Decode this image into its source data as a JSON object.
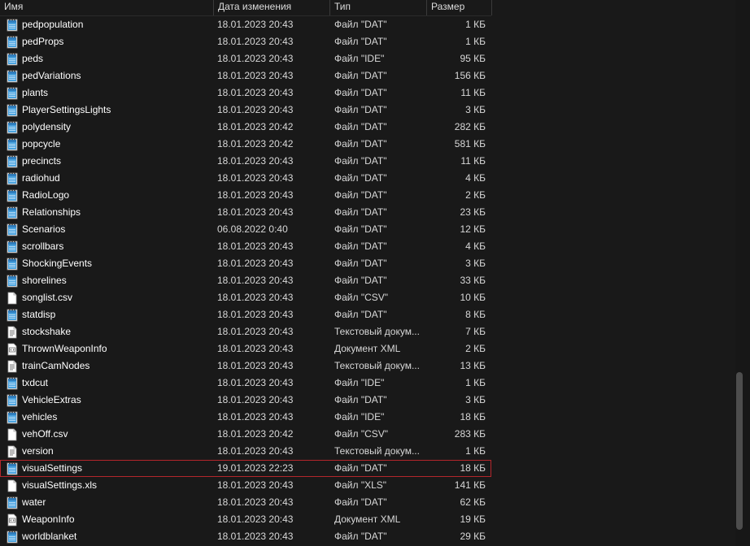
{
  "header": {
    "name": "Имя",
    "date": "Дата изменения",
    "type": "Тип",
    "size": "Размер"
  },
  "colors": {
    "background": "#191919",
    "selection_outline": "#b3262b",
    "notepad_icon": "#4aa3df"
  },
  "files": [
    {
      "name": "pedpopulation",
      "date": "18.01.2023 20:43",
      "type": "Файл \"DAT\"",
      "size": "1 КБ",
      "icon": "notepad-file-icon"
    },
    {
      "name": "pedProps",
      "date": "18.01.2023 20:43",
      "type": "Файл \"DAT\"",
      "size": "1 КБ",
      "icon": "notepad-file-icon"
    },
    {
      "name": "peds",
      "date": "18.01.2023 20:43",
      "type": "Файл \"IDE\"",
      "size": "95 КБ",
      "icon": "notepad-file-icon"
    },
    {
      "name": "pedVariations",
      "date": "18.01.2023 20:43",
      "type": "Файл \"DAT\"",
      "size": "156 КБ",
      "icon": "notepad-file-icon"
    },
    {
      "name": "plants",
      "date": "18.01.2023 20:43",
      "type": "Файл \"DAT\"",
      "size": "11 КБ",
      "icon": "notepad-file-icon"
    },
    {
      "name": "PlayerSettingsLights",
      "date": "18.01.2023 20:43",
      "type": "Файл \"DAT\"",
      "size": "3 КБ",
      "icon": "notepad-file-icon"
    },
    {
      "name": "polydensity",
      "date": "18.01.2023 20:42",
      "type": "Файл \"DAT\"",
      "size": "282 КБ",
      "icon": "notepad-file-icon"
    },
    {
      "name": "popcycle",
      "date": "18.01.2023 20:42",
      "type": "Файл \"DAT\"",
      "size": "581 КБ",
      "icon": "notepad-file-icon"
    },
    {
      "name": "precincts",
      "date": "18.01.2023 20:43",
      "type": "Файл \"DAT\"",
      "size": "11 КБ",
      "icon": "notepad-file-icon"
    },
    {
      "name": "radiohud",
      "date": "18.01.2023 20:43",
      "type": "Файл \"DAT\"",
      "size": "4 КБ",
      "icon": "notepad-file-icon"
    },
    {
      "name": "RadioLogo",
      "date": "18.01.2023 20:43",
      "type": "Файл \"DAT\"",
      "size": "2 КБ",
      "icon": "notepad-file-icon"
    },
    {
      "name": "Relationships",
      "date": "18.01.2023 20:43",
      "type": "Файл \"DAT\"",
      "size": "23 КБ",
      "icon": "notepad-file-icon"
    },
    {
      "name": "Scenarios",
      "date": "06.08.2022 0:40",
      "type": "Файл \"DAT\"",
      "size": "12 КБ",
      "icon": "notepad-file-icon"
    },
    {
      "name": "scrollbars",
      "date": "18.01.2023 20:43",
      "type": "Файл \"DAT\"",
      "size": "4 КБ",
      "icon": "notepad-file-icon"
    },
    {
      "name": "ShockingEvents",
      "date": "18.01.2023 20:43",
      "type": "Файл \"DAT\"",
      "size": "3 КБ",
      "icon": "notepad-file-icon"
    },
    {
      "name": "shorelines",
      "date": "18.01.2023 20:43",
      "type": "Файл \"DAT\"",
      "size": "33 КБ",
      "icon": "notepad-file-icon"
    },
    {
      "name": "songlist.csv",
      "date": "18.01.2023 20:43",
      "type": "Файл \"CSV\"",
      "size": "10 КБ",
      "icon": "blank-file-icon"
    },
    {
      "name": "statdisp",
      "date": "18.01.2023 20:43",
      "type": "Файл \"DAT\"",
      "size": "8 КБ",
      "icon": "notepad-file-icon"
    },
    {
      "name": "stockshake",
      "date": "18.01.2023 20:43",
      "type": "Текстовый докум...",
      "size": "7 КБ",
      "icon": "text-document-icon"
    },
    {
      "name": "ThrownWeaponInfo",
      "date": "18.01.2023 20:43",
      "type": "Документ XML",
      "size": "2 КБ",
      "icon": "xml-document-icon"
    },
    {
      "name": "trainCamNodes",
      "date": "18.01.2023 20:43",
      "type": "Текстовый докум...",
      "size": "13 КБ",
      "icon": "text-document-icon"
    },
    {
      "name": "txdcut",
      "date": "18.01.2023 20:43",
      "type": "Файл \"IDE\"",
      "size": "1 КБ",
      "icon": "notepad-file-icon"
    },
    {
      "name": "VehicleExtras",
      "date": "18.01.2023 20:43",
      "type": "Файл \"DAT\"",
      "size": "3 КБ",
      "icon": "notepad-file-icon"
    },
    {
      "name": "vehicles",
      "date": "18.01.2023 20:43",
      "type": "Файл \"IDE\"",
      "size": "18 КБ",
      "icon": "notepad-file-icon"
    },
    {
      "name": "vehOff.csv",
      "date": "18.01.2023 20:42",
      "type": "Файл \"CSV\"",
      "size": "283 КБ",
      "icon": "blank-file-icon"
    },
    {
      "name": "version",
      "date": "18.01.2023 20:43",
      "type": "Текстовый докум...",
      "size": "1 КБ",
      "icon": "text-document-icon"
    },
    {
      "name": "visualSettings",
      "date": "19.01.2023 22:23",
      "type": "Файл \"DAT\"",
      "size": "18 КБ",
      "icon": "notepad-file-icon",
      "selected": true
    },
    {
      "name": "visualSettings.xls",
      "date": "18.01.2023 20:43",
      "type": "Файл \"XLS\"",
      "size": "141 КБ",
      "icon": "blank-file-icon"
    },
    {
      "name": "water",
      "date": "18.01.2023 20:43",
      "type": "Файл \"DAT\"",
      "size": "62 КБ",
      "icon": "notepad-file-icon"
    },
    {
      "name": "WeaponInfo",
      "date": "18.01.2023 20:43",
      "type": "Документ XML",
      "size": "19 КБ",
      "icon": "xml-document-icon"
    },
    {
      "name": "worldblanket",
      "date": "18.01.2023 20:43",
      "type": "Файл \"DAT\"",
      "size": "29 КБ",
      "icon": "notepad-file-icon"
    }
  ]
}
